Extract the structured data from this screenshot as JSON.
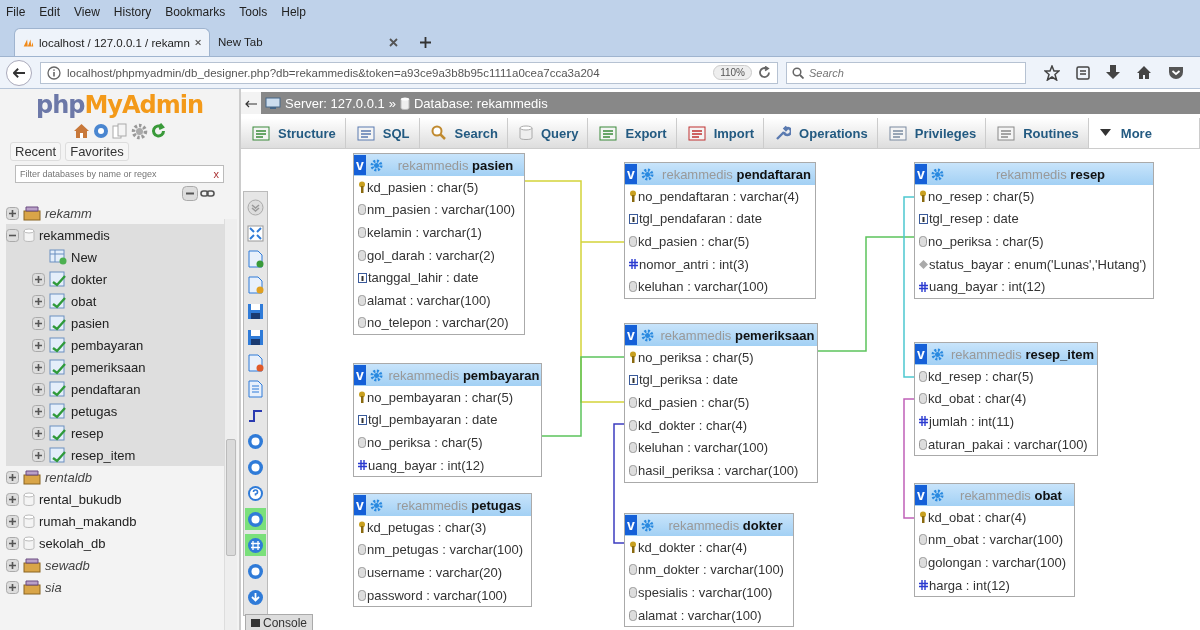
{
  "browser": {
    "menu": [
      "File",
      "Edit",
      "View",
      "History",
      "Bookmarks",
      "Tools",
      "Help"
    ],
    "tabs": [
      {
        "title": "localhost / 127.0.0.1 / rekamn",
        "selected": true
      },
      {
        "title": "New Tab",
        "selected": false
      }
    ],
    "url": "localhost/phpmyadmin/db_designer.php?db=rekammedis&token=a93ce9a3b8b95c1111a0cea7cca3a204",
    "zoom": "110%",
    "search": {
      "placeholder": "Search"
    }
  },
  "sidebar": {
    "logo": {
      "prefix": "php",
      "main": "MyAdmin"
    },
    "buttons": [
      "Recent",
      "Favorites"
    ],
    "filter": {
      "placeholder": "Filter databases by name or regex",
      "clear": "x"
    },
    "tree": [
      {
        "name": "rekamm",
        "kind": "package",
        "expanded": false
      },
      {
        "name": "rekammedis",
        "kind": "database",
        "expanded": true,
        "children": [
          {
            "name": "New",
            "kind": "new"
          },
          {
            "name": "dokter",
            "kind": "table",
            "expanded": false
          },
          {
            "name": "obat",
            "kind": "table",
            "expanded": false
          },
          {
            "name": "pasien",
            "kind": "table",
            "expanded": false
          },
          {
            "name": "pembayaran",
            "kind": "table",
            "expanded": false
          },
          {
            "name": "pemeriksaan",
            "kind": "table",
            "expanded": false
          },
          {
            "name": "pendaftaran",
            "kind": "table",
            "expanded": false
          },
          {
            "name": "petugas",
            "kind": "table",
            "expanded": false
          },
          {
            "name": "resep",
            "kind": "table",
            "expanded": false
          },
          {
            "name": "resep_item",
            "kind": "table",
            "expanded": false
          }
        ]
      },
      {
        "name": "rentaldb",
        "kind": "package",
        "expanded": false
      },
      {
        "name": "rental_bukudb",
        "kind": "database",
        "expanded": false
      },
      {
        "name": "rumah_makandb",
        "kind": "database",
        "expanded": false
      },
      {
        "name": "sekolah_db",
        "kind": "database",
        "expanded": false
      },
      {
        "name": "sewadb",
        "kind": "package",
        "expanded": false
      },
      {
        "name": "sia",
        "kind": "package",
        "expanded": false
      }
    ]
  },
  "breadcrumb": {
    "server": "Server: 127.0.0.1",
    "separator": "»",
    "database": "Database: rekammedis"
  },
  "tabs": [
    {
      "label": "Structure",
      "kind": "structure"
    },
    {
      "label": "SQL",
      "kind": "sql"
    },
    {
      "label": "Search",
      "kind": "search"
    },
    {
      "label": "Query",
      "kind": "query"
    },
    {
      "label": "Export",
      "kind": "export"
    },
    {
      "label": "Import",
      "kind": "import"
    },
    {
      "label": "Operations",
      "kind": "operations"
    },
    {
      "label": "Privileges",
      "kind": "privileges"
    },
    {
      "label": "Routines",
      "kind": "routines"
    },
    {
      "label": "More",
      "kind": "more"
    }
  ],
  "tools": [
    {
      "kind": "chevron",
      "on": false
    },
    {
      "kind": "fullscreen",
      "on": false
    },
    {
      "kind": "page-add",
      "on": false
    },
    {
      "kind": "page-edit",
      "on": false
    },
    {
      "kind": "save",
      "on": false
    },
    {
      "kind": "save",
      "on": false
    },
    {
      "kind": "page-delete",
      "on": false
    },
    {
      "kind": "list",
      "on": false
    },
    {
      "kind": "relation",
      "on": false
    },
    {
      "kind": "circle",
      "on": false
    },
    {
      "kind": "circle",
      "on": false
    },
    {
      "kind": "help",
      "on": false
    },
    {
      "kind": "circle",
      "on": true
    },
    {
      "kind": "grid",
      "on": true
    },
    {
      "kind": "circle",
      "on": false
    },
    {
      "kind": "download",
      "on": false
    }
  ],
  "console": "Console",
  "tables": [
    {
      "toggle": "v",
      "schema": "rekammedis",
      "name": "pasien",
      "columns": [
        {
          "text": "kd_pasien : char(5)",
          "kind": "key"
        },
        {
          "text": "nm_pasien : varchar(100)",
          "kind": "text"
        },
        {
          "text": "kelamin : varchar(1)",
          "kind": "text"
        },
        {
          "text": "gol_darah : varchar(2)",
          "kind": "text"
        },
        {
          "text": "tanggal_lahir : date",
          "kind": "date"
        },
        {
          "text": "alamat : varchar(100)",
          "kind": "text"
        },
        {
          "text": "no_telepon : varchar(20)",
          "kind": "text"
        }
      ]
    },
    {
      "toggle": "v",
      "schema": "rekammedis",
      "name": "pembayaran",
      "columns": [
        {
          "text": "no_pembayaran : char(5)",
          "kind": "key"
        },
        {
          "text": "tgl_pembayaran : date",
          "kind": "date"
        },
        {
          "text": "no_periksa : char(5)",
          "kind": "text"
        },
        {
          "text": "uang_bayar : int(12)",
          "kind": "number"
        }
      ]
    },
    {
      "toggle": "v",
      "schema": "rekammedis",
      "name": "petugas",
      "columns": [
        {
          "text": "kd_petugas : char(3)",
          "kind": "key"
        },
        {
          "text": "nm_petugas : varchar(100)",
          "kind": "text"
        },
        {
          "text": "username : varchar(20)",
          "kind": "text"
        },
        {
          "text": "password : varchar(100)",
          "kind": "text"
        }
      ]
    },
    {
      "toggle": "v",
      "schema": "rekammedis",
      "name": "pendaftaran",
      "columns": [
        {
          "text": "no_pendaftaran : varchar(4)",
          "kind": "key"
        },
        {
          "text": "tgl_pendafaran : date",
          "kind": "date"
        },
        {
          "text": "kd_pasien : char(5)",
          "kind": "text"
        },
        {
          "text": "nomor_antri : int(3)",
          "kind": "number"
        },
        {
          "text": "keluhan : varchar(100)",
          "kind": "text"
        }
      ]
    },
    {
      "toggle": "v",
      "schema": "rekammedis",
      "name": "pemeriksaan",
      "columns": [
        {
          "text": "no_periksa : char(5)",
          "kind": "key"
        },
        {
          "text": "tgl_periksa : date",
          "kind": "date"
        },
        {
          "text": "kd_pasien : char(5)",
          "kind": "text"
        },
        {
          "text": "kd_dokter : char(4)",
          "kind": "text"
        },
        {
          "text": "keluhan : varchar(100)",
          "kind": "text"
        },
        {
          "text": "hasil_periksa : varchar(100)",
          "kind": "text"
        }
      ]
    },
    {
      "toggle": "v",
      "schema": "rekammedis",
      "name": "dokter",
      "columns": [
        {
          "text": "kd_dokter : char(4)",
          "kind": "key"
        },
        {
          "text": "nm_dokter : varchar(100)",
          "kind": "text"
        },
        {
          "text": "spesialis : varchar(100)",
          "kind": "text"
        },
        {
          "text": "alamat : varchar(100)",
          "kind": "text"
        }
      ]
    },
    {
      "toggle": "v",
      "schema": "rekammedis",
      "name": "resep",
      "columns": [
        {
          "text": "no_resep : char(5)",
          "kind": "key"
        },
        {
          "text": "tgl_resep : date",
          "kind": "date"
        },
        {
          "text": "no_periksa : char(5)",
          "kind": "text"
        },
        {
          "text": "status_bayar : enum('Lunas','Hutang')",
          "kind": "enum"
        },
        {
          "text": "uang_bayar : int(12)",
          "kind": "number"
        }
      ]
    },
    {
      "toggle": "v",
      "schema": "rekammedis",
      "name": "resep_item",
      "columns": [
        {
          "text": "kd_resep : char(5)",
          "kind": "text"
        },
        {
          "text": "kd_obat : char(4)",
          "kind": "text"
        },
        {
          "text": "jumlah : int(11)",
          "kind": "number"
        },
        {
          "text": "aturan_pakai : varchar(100)",
          "kind": "text"
        }
      ]
    },
    {
      "toggle": "v",
      "schema": "rekammedis",
      "name": "obat",
      "columns": [
        {
          "text": "kd_obat : char(4)",
          "kind": "key"
        },
        {
          "text": "nm_obat : varchar(100)",
          "kind": "text"
        },
        {
          "text": "golongan : varchar(100)",
          "kind": "text"
        },
        {
          "text": "harga : int(12)",
          "kind": "number"
        }
      ]
    }
  ]
}
